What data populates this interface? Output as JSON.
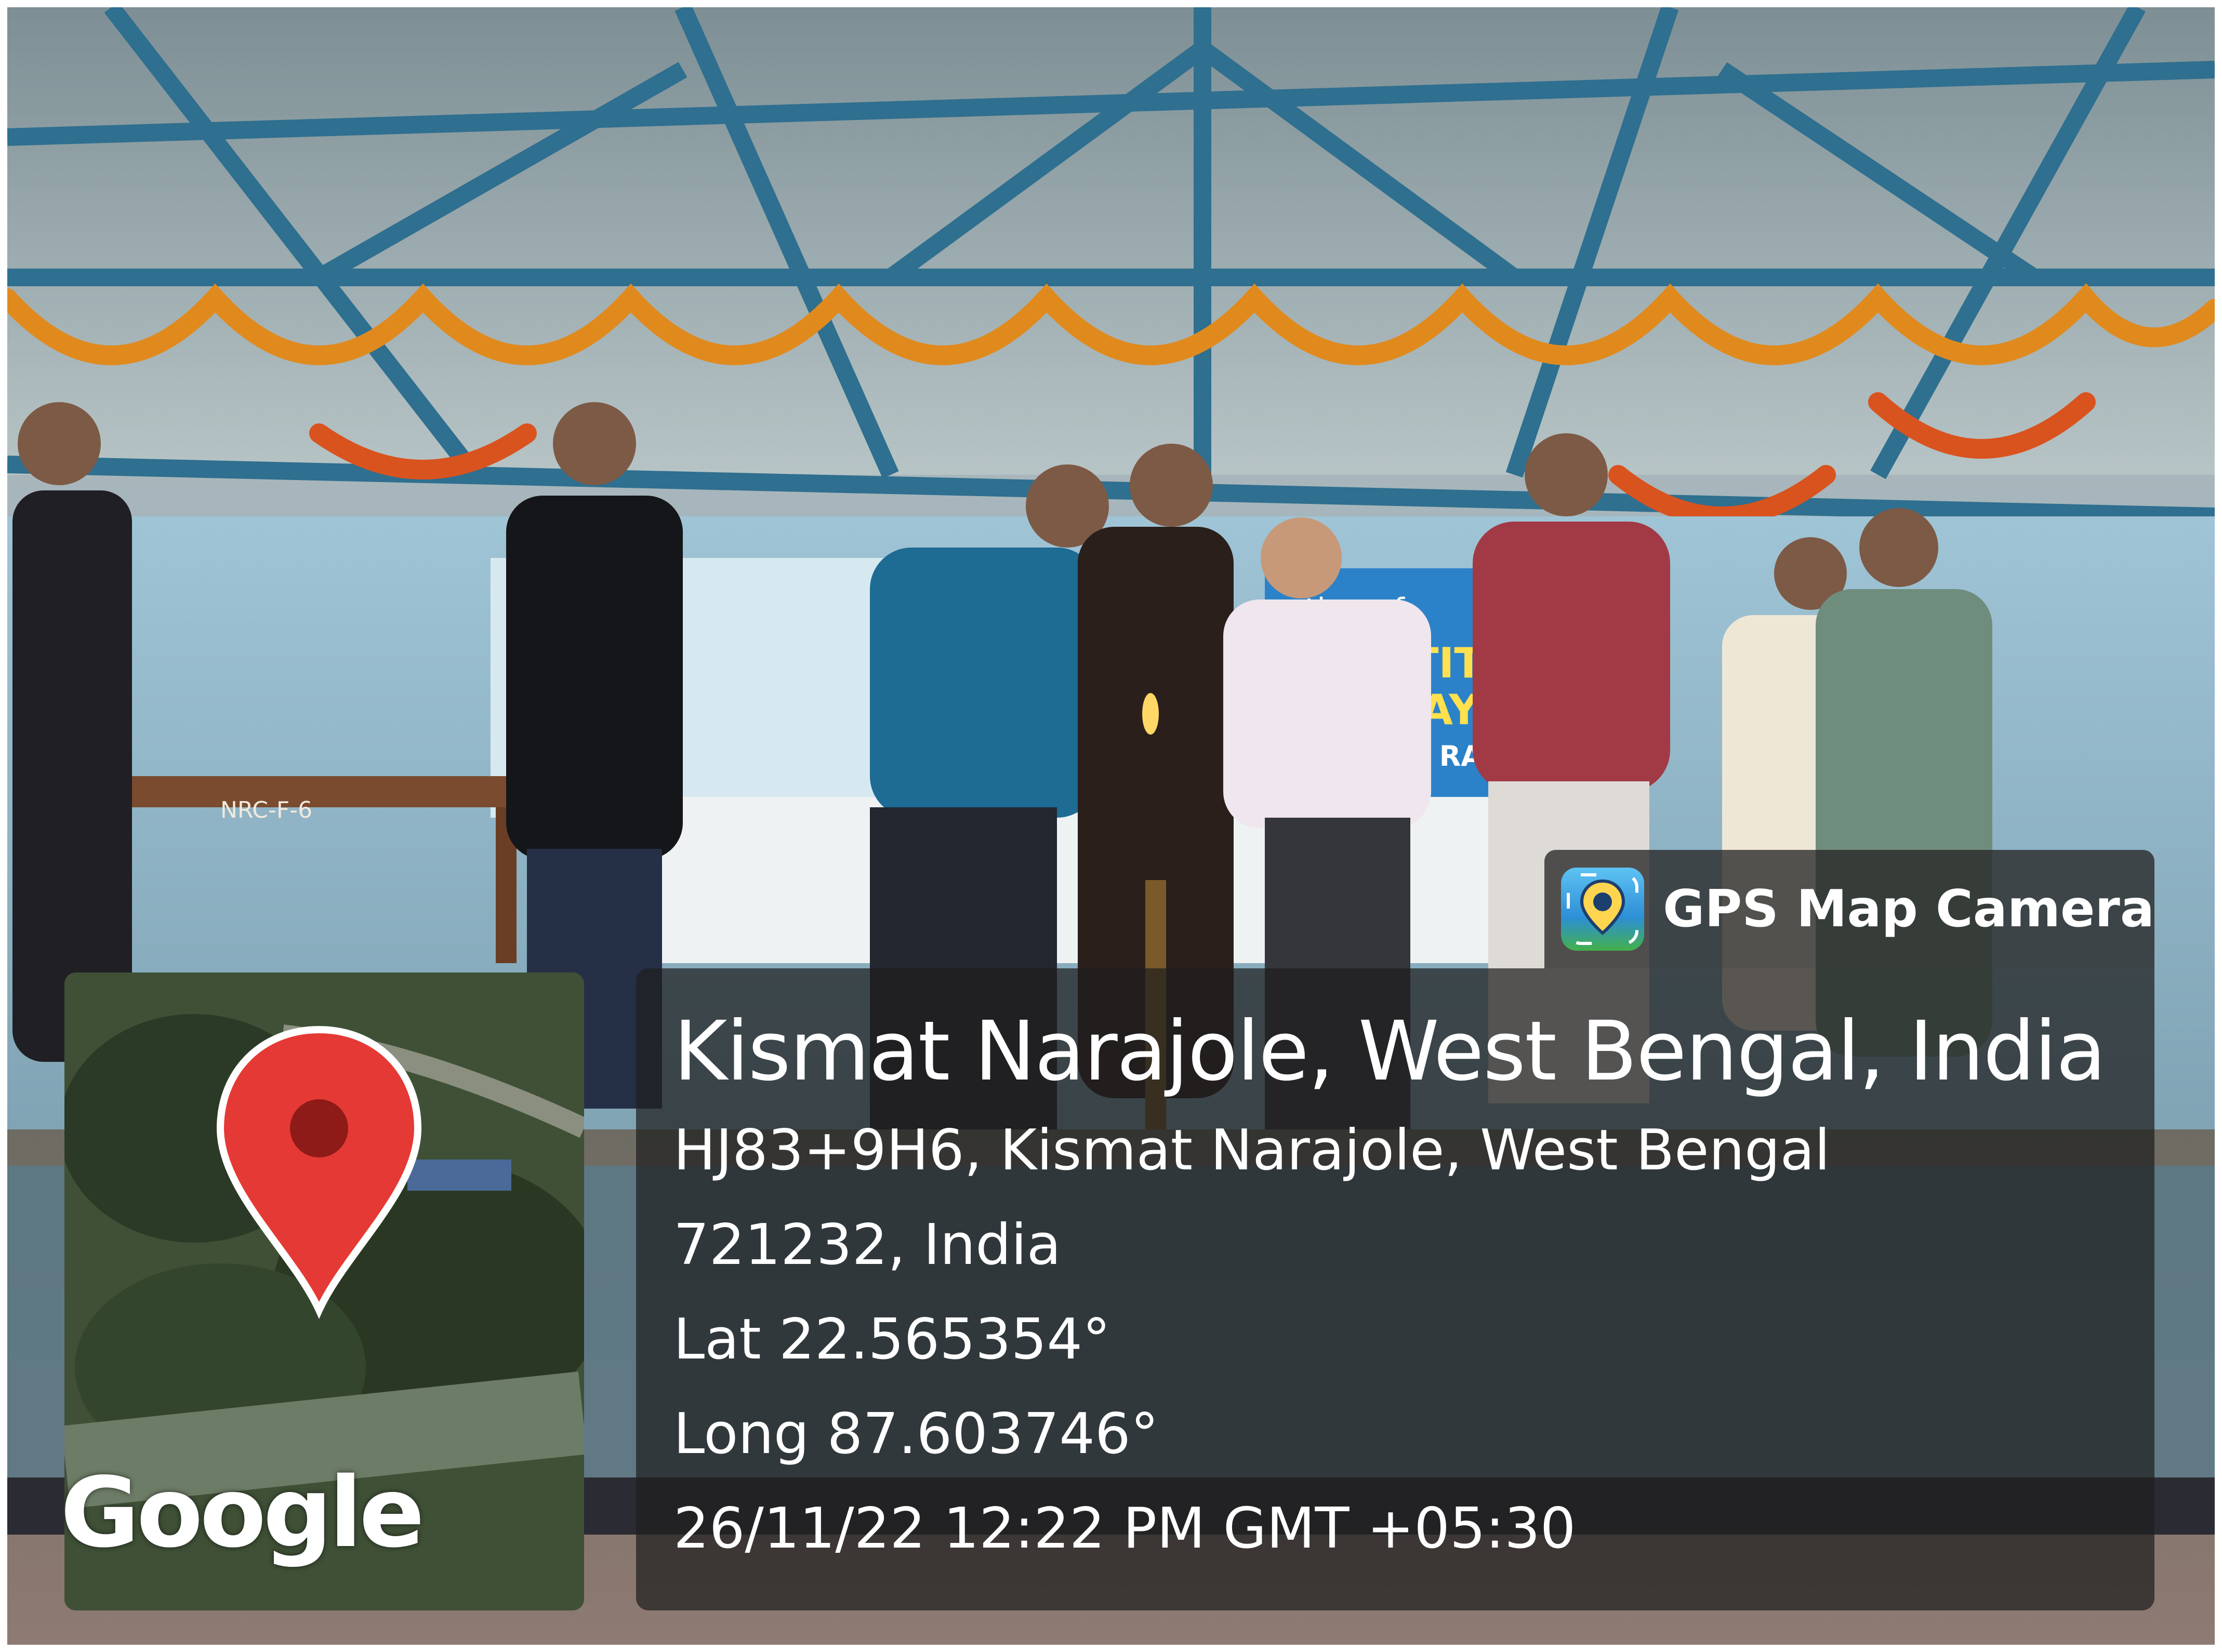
{
  "overlay": {
    "app_label": "GPS Map Camera",
    "app_icon": "gps-map-camera-icon",
    "location_title": "Kismat Narajole, West Bengal, India",
    "address_line1": "HJ83+9H6, Kismat Narajole, West Bengal",
    "address_line2": "721232, India",
    "latitude": "Lat 22.565354°",
    "longitude": "Long 87.603746°",
    "datetime": "26/11/22 12:22 PM GMT +05:30",
    "map_logo": "Google",
    "map_marker_icon": "map-pin-icon",
    "marker_color": "#e53935"
  },
  "photo": {
    "table_label": "NRC-F-6",
    "banner_fragments": [
      "ation of",
      "TITU",
      "AY",
      "E RAJ"
    ]
  }
}
